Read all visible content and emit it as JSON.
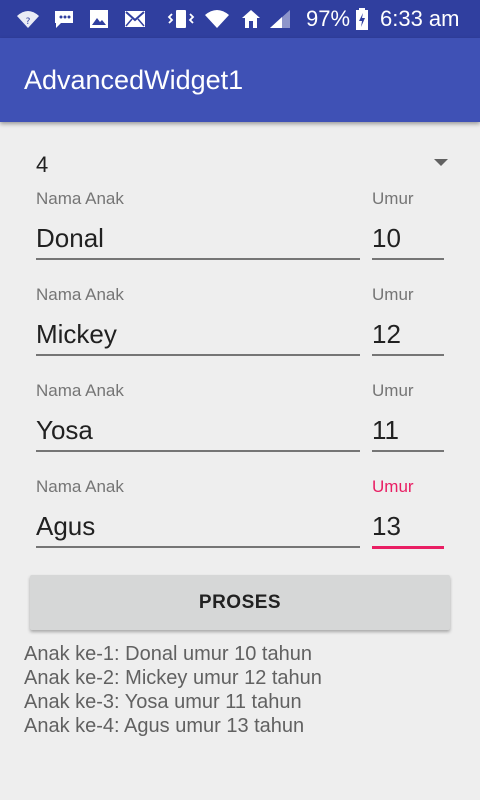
{
  "status_bar": {
    "battery": "97%",
    "time": "6:33 am",
    "icons": [
      "wifi-question-icon",
      "bbm-icon",
      "image-icon",
      "mail-icon",
      "vibrate-icon",
      "wifi-icon",
      "home-icon",
      "signal-icon",
      "battery-charging-icon"
    ]
  },
  "app_bar": {
    "title": "AdvancedWidget1"
  },
  "spinner": {
    "selected": "4"
  },
  "children": [
    {
      "name_label": "Nama Anak",
      "name": "Donal",
      "age_label": "Umur",
      "age": "10"
    },
    {
      "name_label": "Nama Anak",
      "name": "Mickey",
      "age_label": "Umur",
      "age": "12"
    },
    {
      "name_label": "Nama Anak",
      "name": "Yosa",
      "age_label": "Umur",
      "age": "11"
    },
    {
      "name_label": "Nama Anak",
      "name": "Agus",
      "age_label": "Umur",
      "age": "13"
    }
  ],
  "process_button": {
    "label": "PROSES"
  },
  "output": [
    "Anak ke-1: Donal umur 10 tahun",
    "Anak ke-2: Mickey umur 12 tahun",
    "Anak ke-3: Yosa umur 11 tahun",
    "Anak ke-4: Agus umur 13 tahun"
  ],
  "colors": {
    "status_bar": "#303f9f",
    "app_bar": "#3f51b5",
    "accent": "#e91e63",
    "background": "#eeeeee"
  }
}
